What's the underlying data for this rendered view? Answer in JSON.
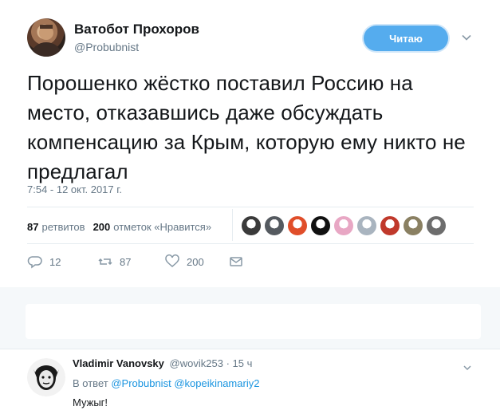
{
  "tweet": {
    "author_name": "Ватобот Прохоров",
    "author_handle": "@Probubnist",
    "follow_label": "Читаю",
    "text": "Порошенко жёстко поставил Россию на место, отказавшись даже обсуждать компенсацию за Крым, которую ему никто не предлагал",
    "timestamp": "7:54 - 12 окт. 2017 г.",
    "stats": {
      "retweets_count": "87",
      "retweets_label": "ретвитов",
      "likes_count": "200",
      "likes_label": "отметок «Нравится»"
    },
    "likers": [
      "#3a3a3a",
      "#555a60",
      "#e04e2a",
      "#111111",
      "#e8a7c4",
      "#a9b4bf",
      "#c0392b",
      "#8a8062",
      "#6d6d6d"
    ],
    "actions": {
      "reply_count": "12",
      "retweet_count": "87",
      "like_count": "200"
    }
  },
  "reply": {
    "author_name": "Vladimir Vanovsky",
    "author_handle": "@wovik253",
    "time": "· 15 ч",
    "reply_to_prefix": "В ответ",
    "mention1": "@Probubnist",
    "mention2": "@kopeikinamariy2",
    "text": "Мужыг!"
  },
  "colors": {
    "accent": "#55acee",
    "link": "#1b95e0",
    "muted": "#657786",
    "text": "#14171a"
  }
}
